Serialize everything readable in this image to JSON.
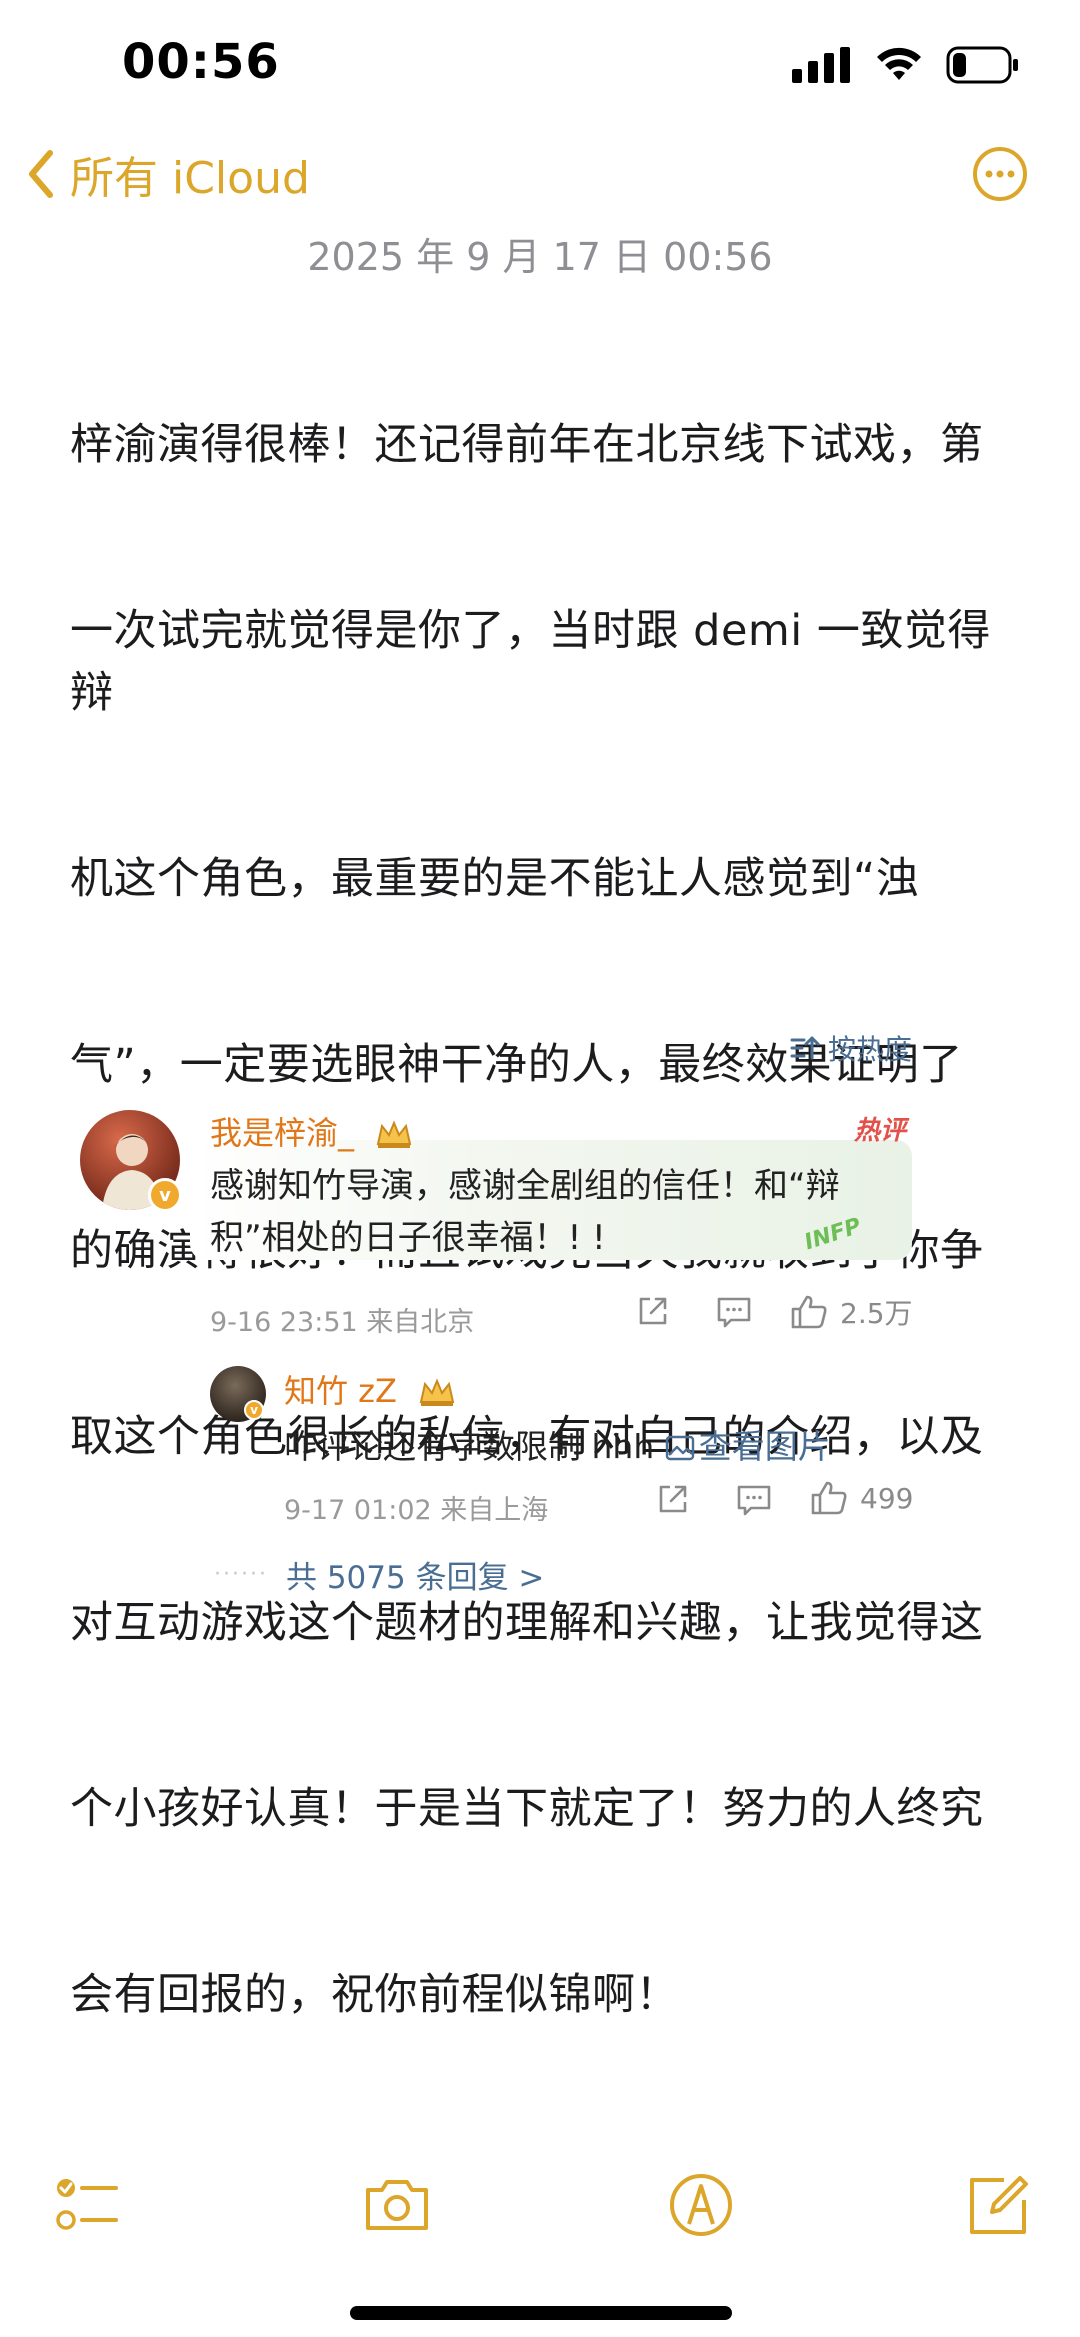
{
  "status_bar": {
    "time": "00:56",
    "battery_level": 0.25
  },
  "nav": {
    "back_label": "所有 iCloud",
    "accent_color": "#dca62b",
    "more_icon": "more-circle-icon"
  },
  "note": {
    "date": "2025 年 9 月 17 日 00:56",
    "lines": [
      "梓渝演得很棒！还记得前年在北京线下试戏，第",
      "一次试完就觉得是你了，当时跟 demi 一致觉得辩",
      "机这个角色，最重要的是不能让人感觉到“浊",
      "气”，一定要选眼神干净的人，最终效果证明了",
      "的确演得很好！而且试戏完当天我就收到了你争",
      "取这个角色很长的私信，有对自己的介绍，以及",
      "对互动游戏这个题材的理解和兴趣，让我觉得这",
      "个小孩好认真！于是当下就定了！努力的人终究",
      "会有回报的，祝你前程似锦啊！"
    ]
  },
  "comments": {
    "sort_label": "按热度",
    "main": {
      "author": "我是梓渝_",
      "hot_tag": "热评",
      "text_line1": "感谢知竹导演，感谢全剧组的信任！和“辩",
      "text_line2": "积”相处的日子很幸福！! !",
      "sticker": "INFP",
      "meta": "9-16 23:51  来自北京",
      "likes": "2.5万"
    },
    "reply": {
      "author": "知竹 zZ",
      "text": "咋评论还有字数限制 hhh ",
      "link": "查看图片",
      "meta": "9-17 01:02  来自上海",
      "likes": "499"
    },
    "more_dots": "······",
    "more_replies": "共 5075 条回复 >"
  },
  "toolbar": {
    "icons": [
      "checklist-icon",
      "camera-icon",
      "markup-pen-icon",
      "compose-icon"
    ]
  }
}
